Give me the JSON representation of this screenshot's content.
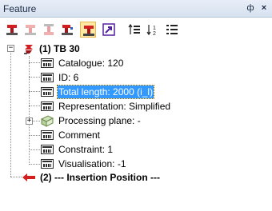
{
  "panel": {
    "title": "Feature",
    "pin_glyph": "ф",
    "close_glyph": "×"
  },
  "toolbar": {
    "buttons": [
      {
        "icon": "beam-red-down-icon"
      },
      {
        "icon": "beam-faded-down-icon"
      },
      {
        "icon": "beam-faded-up-icon"
      },
      {
        "icon": "beam-red-insert-icon"
      },
      {
        "icon": "beam-insert-active-icon",
        "active": true
      },
      {
        "icon": "jump-arrow-icon"
      },
      {
        "icon": "sort-up-icon"
      },
      {
        "icon": "sort-down-icon"
      },
      {
        "icon": "list-view-icon"
      }
    ]
  },
  "tree": {
    "root": {
      "label": "(1) TB 30",
      "expander": "−"
    },
    "children": [
      {
        "label": "Catalogue: 120"
      },
      {
        "label": "ID: 6"
      },
      {
        "label": "Total length: 2000 (i_l)",
        "selected": true
      },
      {
        "label": "Representation: Simplified"
      },
      {
        "label": "Processing plane: -",
        "expander": "+"
      },
      {
        "label": "Comment"
      },
      {
        "label": "Constraint: 1"
      },
      {
        "label": "Visualisation: -1"
      }
    ],
    "insertion": {
      "label": "(2) --- Insertion Position ---"
    }
  },
  "colors": {
    "selection": "#3399ff",
    "accent_red": "#d21f1f",
    "titlebar": "#d6e0ef"
  }
}
